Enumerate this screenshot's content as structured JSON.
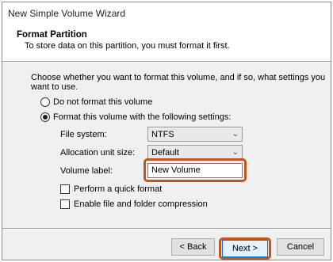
{
  "window": {
    "title": "New Simple Volume Wizard"
  },
  "header": {
    "title": "Format Partition",
    "subtitle": "To store data on this partition, you must format it first."
  },
  "intro_text": "Choose whether you want to format this volume, and if so, what settings you want to use.",
  "options": {
    "no_format": {
      "label": "Do not format this volume",
      "selected": false
    },
    "format": {
      "label": "Format this volume with the following settings:",
      "selected": true
    }
  },
  "settings": {
    "file_system": {
      "label": "File system:",
      "value": "NTFS"
    },
    "allocation": {
      "label": "Allocation unit size:",
      "value": "Default"
    },
    "volume_label": {
      "label": "Volume label:",
      "value": "New Volume"
    }
  },
  "checkboxes": {
    "quick_format": {
      "label": "Perform a quick format",
      "checked": false
    },
    "compression": {
      "label": "Enable file and folder compression",
      "checked": false
    }
  },
  "buttons": {
    "back": "< Back",
    "next": "Next >",
    "cancel": "Cancel"
  },
  "colors": {
    "highlight": "#c0561c",
    "body_bg": "#f0f0f0"
  }
}
